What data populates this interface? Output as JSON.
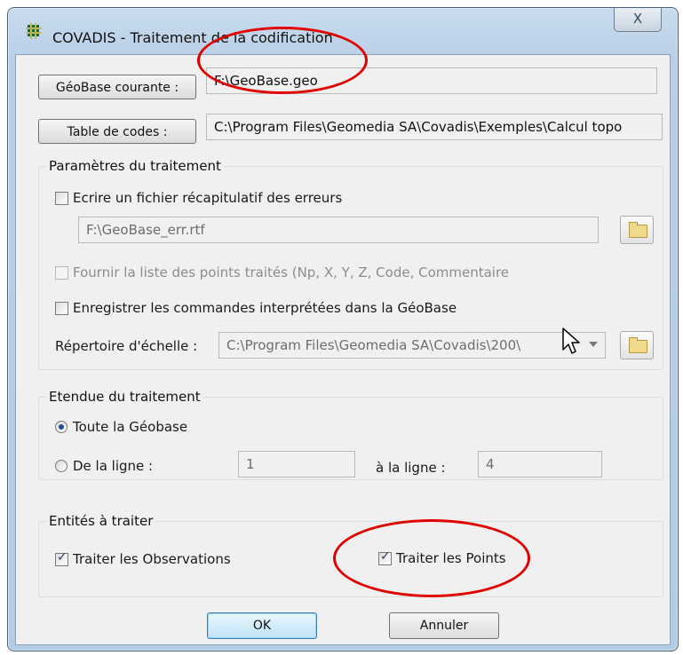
{
  "window": {
    "title": "COVADIS - Traitement de la codification",
    "close_glyph": "X"
  },
  "geobase": {
    "button_label": "GéoBase courante :",
    "value": "F:\\GeoBase.geo"
  },
  "table_codes": {
    "button_label": "Table de codes :",
    "value": "C:\\Program Files\\Geomedia SA\\Covadis\\Exemples\\Calcul topo"
  },
  "params": {
    "legend": "Paramètres du traitement",
    "ecrire_label": "Ecrire un fichier récapitulatif des erreurs",
    "ecrire_checked": false,
    "err_file_value": "F:\\GeoBase_err.rtf",
    "fournir_label": "Fournir la liste des points traités (Np, X, Y, Z, Code, Commentaire",
    "fournir_checked": false,
    "enregistrer_label": "Enregistrer les commandes interprétées dans la GéoBase",
    "enregistrer_checked": false,
    "repertoire_label": "Répertoire d'échelle :",
    "repertoire_value": "C:\\Program Files\\Geomedia SA\\Covadis\\200\\"
  },
  "etendue": {
    "legend": "Etendue du traitement",
    "toute_label": "Toute la Géobase",
    "de_ligne_label": "De la ligne :",
    "de_ligne_value": "1",
    "a_ligne_label": "à la ligne :",
    "a_ligne_value": "4",
    "selected": "toute"
  },
  "entites": {
    "legend": "Entités à traiter",
    "observations_label": "Traiter les Observations",
    "observations_checked": true,
    "points_label": "Traiter les Points",
    "points_checked": true
  },
  "buttons": {
    "ok": "OK",
    "annuler": "Annuler"
  },
  "colors": {
    "annotation_red": "#e00000",
    "title_gradient": "#c9dcef",
    "dialog_bg": "#f0f0f0"
  }
}
